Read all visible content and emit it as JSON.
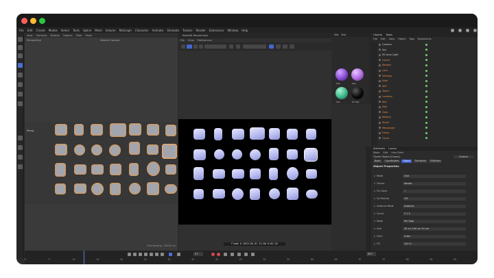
{
  "window": {
    "traffic_lights": [
      "#ff5f57",
      "#febc2e",
      "#28c840"
    ]
  },
  "menubar": {
    "items": [
      "File",
      "Edit",
      "Create",
      "Modes",
      "Select",
      "Tools",
      "Spline",
      "Mesh",
      "Volume",
      "MoGraph",
      "Character",
      "Animate",
      "Simulate",
      "Tracker",
      "Render",
      "Extensions",
      "Window",
      "Help"
    ]
  },
  "viewport": {
    "menu": [
      "View",
      "Cameras",
      "Display",
      "Options",
      "Filter",
      "Panel"
    ],
    "sub_label": "Perspective",
    "sub_label2": "Default Camera",
    "persp_label": "Persp",
    "grid_spacing": "Grid Spacing : 50000 cm"
  },
  "render_view": {
    "title": "Redshift RenderView",
    "menu": [
      "File",
      "View",
      "Preferences"
    ],
    "status": "Frame 0 2023-05-01 12:00 0:02:16"
  },
  "materials": {
    "tabs": [
      "Mat",
      "Mat"
    ],
    "items": [
      {
        "name": "Mat",
        "color": "#8a4bd6"
      },
      {
        "name": "Mat",
        "color": "#b06ae0"
      },
      {
        "name": "Mat",
        "color": "#3db88a"
      },
      {
        "name": "RS Mat",
        "color": "#0a0a0a"
      }
    ]
  },
  "objects": {
    "tabs": [
      "Objects",
      "Takes"
    ],
    "menu": [
      "File",
      "Edit",
      "View",
      "Object",
      "Tags",
      "Bookmarks"
    ],
    "rows": [
      {
        "name": "Camera",
        "selected": false
      },
      {
        "name": "Sky",
        "selected": false
      },
      {
        "name": "RS Area Light",
        "selected": false
      },
      {
        "name": "Cloner",
        "selected": true
      },
      {
        "name": "Refresh",
        "selected": true
      },
      {
        "name": "Lock",
        "selected": true
      },
      {
        "name": "Settings",
        "selected": true
      },
      {
        "name": "Mike",
        "selected": true
      },
      {
        "name": "Wifi",
        "selected": true
      },
      {
        "name": "Tower",
        "selected": true
      },
      {
        "name": "Location",
        "selected": true
      },
      {
        "name": "Bell",
        "selected": true
      },
      {
        "name": "Mail",
        "selected": true
      },
      {
        "name": "Gear",
        "selected": true
      },
      {
        "name": "Battery",
        "selected": true
      },
      {
        "name": "Share",
        "selected": true
      },
      {
        "name": "Messenger",
        "selected": true
      },
      {
        "name": "Home",
        "selected": true
      },
      {
        "name": "Cloud",
        "selected": true
      }
    ]
  },
  "attributes": {
    "tabs": [
      "Attributes",
      "Layers"
    ],
    "menu": [
      "Mode",
      "Edit",
      "User Data"
    ],
    "title": "Cloner Object [Cloner]",
    "mode_value": "Custom",
    "panel_tabs": [
      "Basic",
      "Coordinates",
      "Object",
      "Transform",
      "Effectors"
    ],
    "active_tab": "Object",
    "section": "Object Properties",
    "rows": [
      {
        "label": "Mode",
        "value": "Grid"
      },
      {
        "label": "Clones",
        "value": "Iterate"
      },
      {
        "label": "Fix Clone",
        "value": "✓"
      },
      {
        "label": "Fix Texture",
        "value": "Off"
      },
      {
        "label": "Instance Mode",
        "value": "Instance"
      },
      {
        "label": "Count",
        "value": "5   1   4"
      },
      {
        "label": "Mode",
        "value": "Per Step"
      },
      {
        "label": "Size",
        "value": "50 cm   100 cm   50 cm"
      },
      {
        "label": "Form",
        "value": "Cube"
      },
      {
        "label": "Fill",
        "value": "100 %"
      }
    ]
  },
  "timeline": {
    "current_frame": "0 F",
    "end_frame": "90 F",
    "ticks": [
      "0",
      "5",
      "10",
      "15",
      "20",
      "25",
      "30",
      "35",
      "40",
      "45",
      "50",
      "55",
      "60",
      "65",
      "70",
      "75",
      "80",
      "85",
      "90"
    ]
  }
}
